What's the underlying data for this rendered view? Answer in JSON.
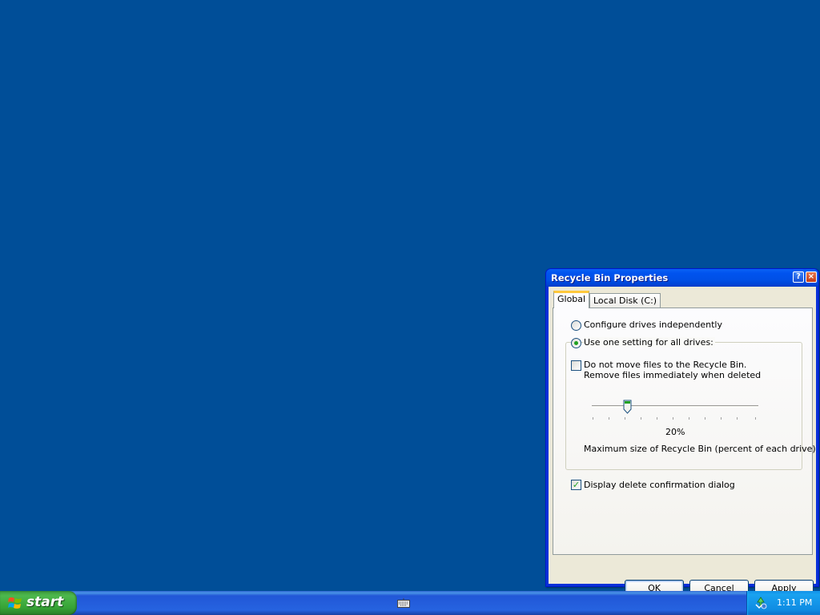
{
  "dialog": {
    "title": "Recycle Bin Properties",
    "help_glyph": "?",
    "close_glyph": "×",
    "tabs": [
      {
        "label": "Global",
        "selected": true
      },
      {
        "label": "Local Disk (C:)",
        "selected": false
      }
    ],
    "options": {
      "configure_independently": {
        "label": "Configure drives independently",
        "selected": false
      },
      "use_one_setting": {
        "label": "Use one setting for all drives:",
        "selected": true
      },
      "do_not_move": {
        "line1": "Do not move files to the Recycle Bin.",
        "line2": "Remove files immediately when deleted",
        "checked": false
      },
      "max_size": {
        "value_label": "20%",
        "value_percent": 20,
        "caption": "Maximum size of Recycle Bin (percent of each drive)"
      },
      "display_confirmation": {
        "label": "Display delete confirmation dialog",
        "checked": true,
        "check_glyph": "✓"
      }
    },
    "buttons": {
      "ok": "OK",
      "cancel": "Cancel",
      "apply": "Apply"
    }
  },
  "taskbar": {
    "start_label": "start",
    "clock": "1:11 PM"
  }
}
